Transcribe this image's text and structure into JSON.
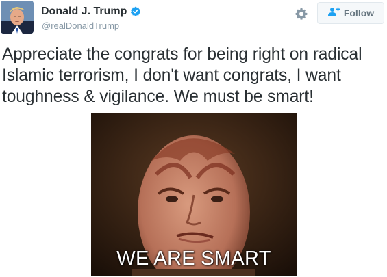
{
  "author": {
    "display_name": "Donald J. Trump",
    "handle": "@realDonaldTrump",
    "verified": true,
    "avatar_icon": "profile-photo"
  },
  "actions": {
    "settings_icon": "gear-icon",
    "follow_icon": "add-user-icon",
    "follow_label": "Follow"
  },
  "tweet": {
    "text": "Appreciate the congrats for being right on radical Islamic terrorism, I don't want congrats, I want toughness & vigilance. We must be smart!"
  },
  "media": {
    "caption": "WE ARE SMART"
  },
  "colors": {
    "name": "#292f33",
    "handle": "#8899a6",
    "verified": "#1da1f2",
    "follow_text": "#66757f",
    "follow_bg": "#f5f8fa"
  }
}
